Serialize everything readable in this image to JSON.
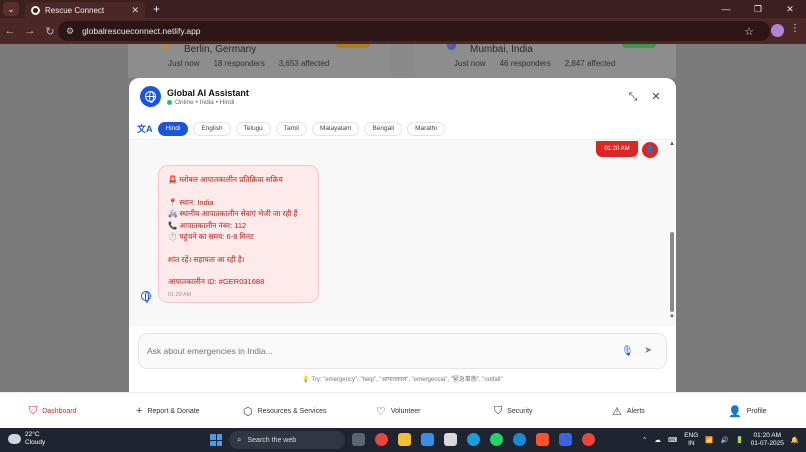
{
  "browser": {
    "tab_title": "Rescue Connect",
    "url": "globalrescueconnect.netlify.app",
    "new_tab": "+",
    "window_controls": [
      "—",
      "❐",
      "✕"
    ]
  },
  "background_cards": [
    {
      "city": "Berlin, Germany",
      "time": "Just now",
      "responders": "18 responders",
      "affected": "3,653 affected"
    },
    {
      "city": "Mumbai, India",
      "time": "Just now",
      "responders": "46 responders",
      "affected": "2,847 affected"
    }
  ],
  "assistant": {
    "title": "Global AI Assistant",
    "status": "Online • India • Hindi",
    "languages": [
      "Hindi",
      "English",
      "Telugu",
      "Tamil",
      "Malayalam",
      "Bengali",
      "Marathi"
    ],
    "active_language": "Hindi",
    "user_message_time": "01:20 AM",
    "bot_message": {
      "lines": [
        "🚨 ग्लोबल आपातकालीन प्रतिक्रिया सक्रिय",
        "",
        "📍 स्थान: India",
        "🚑 स्थानीय आपातकालीन सेवाएं भेजी जा रही हैं",
        "📞 आपातकालीन नंबर: 112",
        "⏱️ पहुंचने का समय: 6-8 मिनट",
        "",
        "शांत रहें। सहायता आ रही है।",
        "",
        "आपातकालीन ID: #GER031688"
      ],
      "time": "01:20 AM"
    },
    "input_placeholder": "Ask about emergencies in India...",
    "hint": "💡 Try: \"emergency\", \"help\", \"आपातकाल\", \"emergencia\", \"緊急事態\", \"notfall\""
  },
  "bottom_nav": [
    {
      "label": "Dashboard",
      "icon": "shield-icon",
      "active": true
    },
    {
      "label": "Report & Donate",
      "icon": "plus-icon",
      "active": false
    },
    {
      "label": "Resources & Services",
      "icon": "box-icon",
      "active": false
    },
    {
      "label": "Volunteer",
      "icon": "heart-icon",
      "active": false
    },
    {
      "label": "Security",
      "icon": "shield-outline-icon",
      "active": false
    },
    {
      "label": "Alerts",
      "icon": "warning-icon",
      "active": false
    },
    {
      "label": "Profile",
      "icon": "user-icon",
      "active": false
    }
  ],
  "taskbar": {
    "temp": "22°C",
    "weather": "Cloudy",
    "search": "Search the web",
    "lang1": "ENG",
    "lang2": "IN",
    "time": "01:20 AM",
    "date": "01-07-2025"
  },
  "colors": {
    "accent": "#1a56db",
    "danger": "#dc2626",
    "bubble": "#fdeaea"
  }
}
